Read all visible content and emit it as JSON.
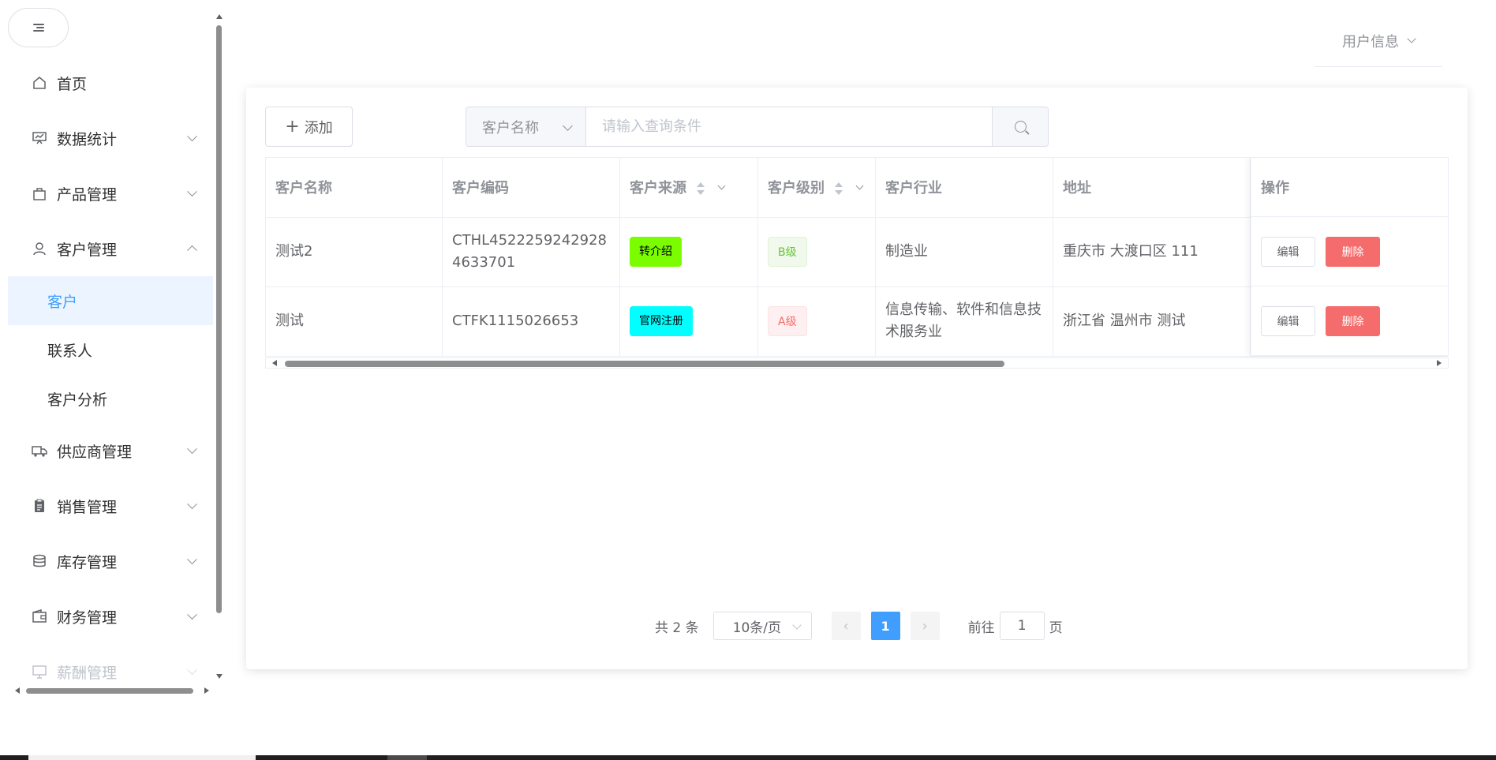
{
  "sidebar": {
    "collapse_icon": "menu-fold-icon",
    "items": [
      {
        "label": "首页",
        "icon": "home-icon"
      },
      {
        "label": "数据统计",
        "icon": "presentation-icon"
      },
      {
        "label": "产品管理",
        "icon": "shopping-bag-icon"
      },
      {
        "label": "客户管理",
        "icon": "user-icon"
      },
      {
        "label": "供应商管理",
        "icon": "truck-icon"
      },
      {
        "label": "销售管理",
        "icon": "clipboard-icon"
      },
      {
        "label": "库存管理",
        "icon": "coins-icon"
      },
      {
        "label": "财务管理",
        "icon": "wallet-icon"
      },
      {
        "label": "薪酬管理",
        "icon": "monitor-icon"
      }
    ],
    "customer_sub": [
      {
        "label": "客户"
      },
      {
        "label": "联系人"
      },
      {
        "label": "客户分析"
      }
    ]
  },
  "header": {
    "user_info": "用户信息"
  },
  "toolbar": {
    "add_label": "添加",
    "search_field": "客户名称",
    "search_placeholder": "请输入查询条件"
  },
  "table": {
    "columns": [
      "客户名称",
      "客户编码",
      "客户来源",
      "客户级别",
      "客户行业",
      "地址",
      "操作"
    ],
    "rows": [
      {
        "name": "测试2",
        "code": "CTHL45222592429284633701",
        "source": "转介绍",
        "level": "B级",
        "industry": "制造业",
        "address": "重庆市 大渡口区 111",
        "edit": "编辑",
        "delete": "删除"
      },
      {
        "name": "测试",
        "code": "CTFK1115026653",
        "source": "官网注册",
        "level": "A级",
        "industry": "信息传输、软件和信息技术服务业",
        "address": "浙江省 温州市 测试",
        "edit": "编辑",
        "delete": "删除"
      }
    ]
  },
  "pagination": {
    "total": "共 2 条",
    "page_size": "10条/页",
    "current": "1",
    "goto_prefix": "前往",
    "goto_value": "1",
    "goto_suffix": "页"
  },
  "colors": {
    "primary": "#409eff",
    "danger": "#f56c6c",
    "source_referral": "#7cfc00",
    "source_website": "#00ffff"
  }
}
